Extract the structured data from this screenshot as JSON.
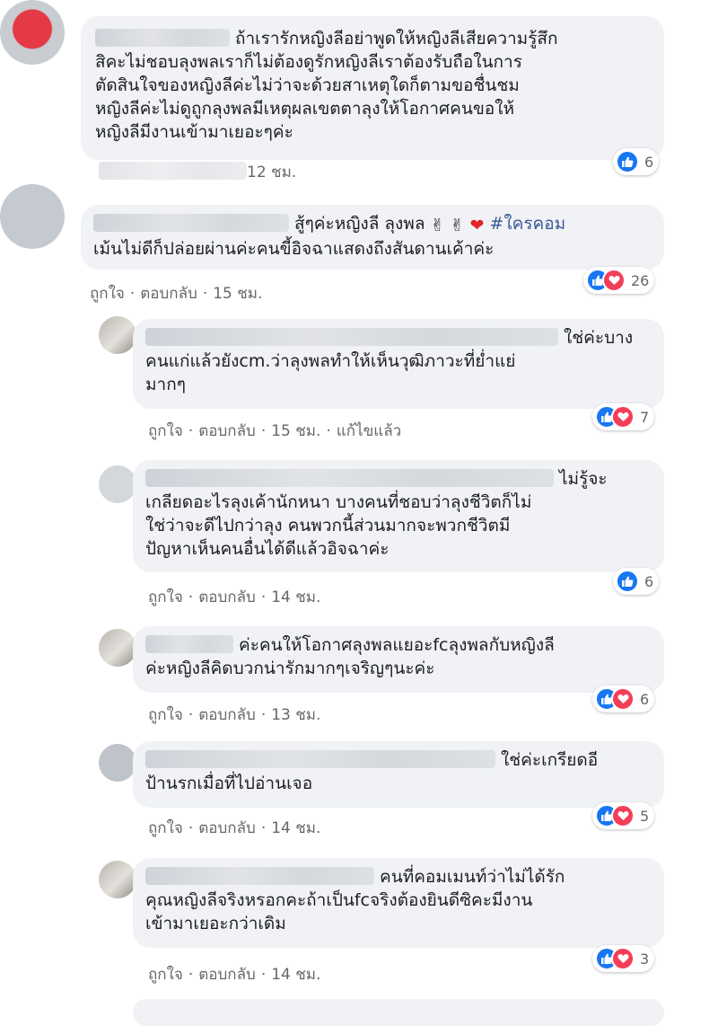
{
  "comments": [
    {
      "lines": [
        "ถ้าเรารักหญิงลีอย่าพูดให้หญิงลีเสียความรู้สึก",
        "สิคะไม่ชอบลุงพลเราก็ไม่ต้องดูรักหญิงลีเราต้องรับถือในการ",
        "ตัดสินใจของหญิงลีค่ะไม่ว่าจะด้วยสาเหตุใดก็ตามขอชื่นชม",
        "หญิงลีค่ะไม่ดูถูกลุงพลมีเหตุผลเขตตาลุงให้โอกาศคนขอให้",
        "หญิงลีมีงานเข้ามาเยอะๆค่ะ"
      ],
      "time": "12 ชม.",
      "reaction_count": "6",
      "reaction_icons": [
        "like-icon"
      ]
    },
    {
      "lines": [
        "สู้ๆค่ะหญิงลี ลุงพล",
        "เม้นไม่ดีก็ปล่อยผ่านค่ะคนขี้อิจฉาแสดงถึงสันดานเค้าค่ะ"
      ],
      "hashtag": "#ใครคอม",
      "like_label": "ถูกใจ",
      "reply_label": "ตอบกลับ",
      "time": "15 ชม.",
      "reaction_count": "26",
      "reaction_icons": [
        "like-icon",
        "love-icon"
      ]
    },
    {
      "lines": [
        "ใช่ค่ะบาง",
        "คนแก่แล้วยังcm.ว่าลุงพลทำให้เห็นวุฒิภาวะที่ย่ำแย่",
        "มากๆ"
      ],
      "like_label": "ถูกใจ",
      "reply_label": "ตอบกลับ",
      "time": "15 ชม.",
      "edited_label": "แก้ไขแล้ว",
      "reaction_count": "7",
      "reaction_icons": [
        "like-icon",
        "love-icon"
      ]
    },
    {
      "lines": [
        "ไม่รู้จะ",
        "เกลียดอะไรลุงเค้านักหนา บางคนที่ชอบว่าลุงชีวิตก็ไม่",
        "ใช่ว่าจะดีไปกว่าลุง คนพวกนี้ส่วนมากจะพวกชีวิตมี",
        "ปัญหาเห็นคนอื่นได้ดีแล้วอิจฉาค่ะ"
      ],
      "like_label": "ถูกใจ",
      "reply_label": "ตอบกลับ",
      "time": "14 ชม.",
      "reaction_count": "6",
      "reaction_icons": [
        "like-icon"
      ]
    },
    {
      "lines": [
        "ค่ะคนให้โอกาศลุงพลแยอะfcลุงพลกับหญิงลี",
        "ค่ะหญิงลีคิดบวกน่ารักมากๆเจริญๆนะค่ะ"
      ],
      "like_label": "ถูกใจ",
      "reply_label": "ตอบกลับ",
      "time": "13 ชม.",
      "reaction_count": "6",
      "reaction_icons": [
        "like-icon",
        "love-icon"
      ]
    },
    {
      "lines": [
        "ใช่ค่ะเกรียดอี",
        "ป้านรกเมื่อที่ไปอ่านเจอ"
      ],
      "like_label": "ถูกใจ",
      "reply_label": "ตอบกลับ",
      "time": "14 ชม.",
      "reaction_count": "5",
      "reaction_icons": [
        "like-icon",
        "love-icon"
      ]
    },
    {
      "lines": [
        "คนที่คอมเมนท์ว่าไม่ได้รัก",
        "คุณหญิงลีจริงหรอกคะถ้าเป็นfcจริงต้องยินดีซิคะมีงาน",
        "เข้ามาเยอะกว่าเดิม"
      ],
      "like_label": "ถูกใจ",
      "reply_label": "ตอบกลับ",
      "time": "14 ชม.",
      "reaction_count": "3",
      "reaction_icons": [
        "like-icon",
        "love-icon"
      ]
    }
  ],
  "colors": {
    "bubble": "#f0f2f5",
    "meta_text": "#65676b",
    "hashtag": "#385898",
    "like": "#1877f2",
    "love": "#f33e58"
  }
}
